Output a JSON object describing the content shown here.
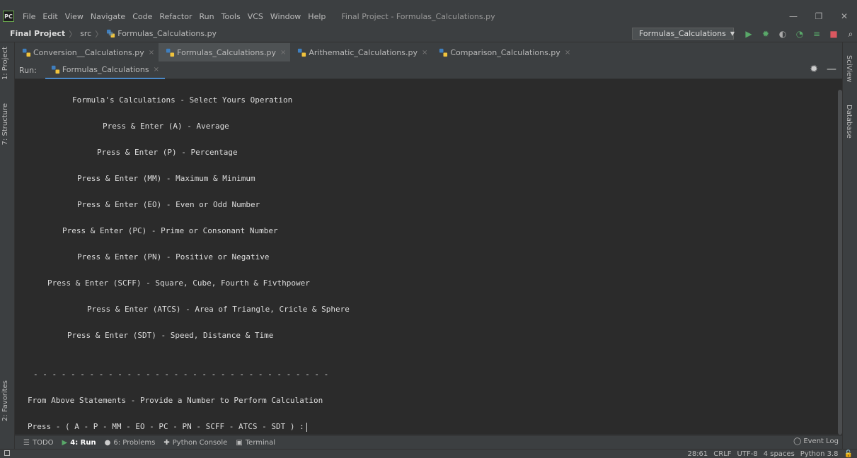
{
  "app": {
    "logo_text": "PC",
    "window_title": "Final Project - Formulas_Calculations.py"
  },
  "menu": [
    "File",
    "Edit",
    "View",
    "Navigate",
    "Code",
    "Refactor",
    "Run",
    "Tools",
    "VCS",
    "Window",
    "Help"
  ],
  "window_controls": {
    "minimize": "—",
    "restore": "❐",
    "close": "✕"
  },
  "navbar": {
    "project": "Final Project",
    "separator": "〉",
    "folder": "src",
    "file": "Formulas_Calculations.py",
    "run_config": "Formulas_Calculations",
    "run_config_caret": "▼"
  },
  "toolbar_icons": {
    "run": "▶",
    "debug": "✹",
    "coverage": "◐",
    "profile": "◔",
    "concurrency": "≡",
    "stop": "■",
    "search": "⌕"
  },
  "left_stripe": {
    "project": "1: Project",
    "structure": "7: Structure",
    "favorites": "2: Favorites"
  },
  "right_stripe": {
    "sciview": "SciView",
    "database": "Database"
  },
  "editor_tabs": [
    {
      "label": "Conversion__Calculations.py",
      "active": false
    },
    {
      "label": "Formulas_Calculations.py",
      "active": true
    },
    {
      "label": "Arithematic_Calculations.py",
      "active": false
    },
    {
      "label": "Comparison_Calculations.py",
      "active": false
    }
  ],
  "tab_close": "×",
  "run_panel": {
    "label": "Run:",
    "tab": "Formulas_Calculations",
    "settings": "✹",
    "minimize": "—"
  },
  "console_lines": [
    "Formula's Calculations - Select Yours Operation",
    "Press & Enter (A) - Average",
    "Press & Enter (P) - Percentage",
    "Press & Enter (MM) - Maximum & Minimum",
    "Press & Enter (EO) - Even or Odd Number",
    "Press & Enter (PC) - Prime or Consonant Number",
    "Press & Enter (PN) - Positive or Negative",
    "Press & Enter (SCFF) - Square, Cube, Fourth & Fivthpower",
    "Press & Enter (ATCS) - Area of Triangle, Cricle & Sphere",
    "Press & Enter (SDT) - Speed, Distance & Time",
    "- - - - - - - - - - - - - - - - - - - - - - - - - - - - - - - -",
    "From Above Statements - Provide a Number to Perform Calculation",
    "Press - ( A - P - MM - EO - PC - PN - SCFF - ATCS - SDT ) :"
  ],
  "bottom_tools": [
    {
      "icon": "☰",
      "label": "TODO",
      "active": false
    },
    {
      "icon": "▶",
      "label": "4: Run",
      "active": true
    },
    {
      "icon": "●",
      "label": "6: Problems",
      "active": false
    },
    {
      "icon": "✚",
      "label": "Python Console",
      "active": false
    },
    {
      "icon": "▣",
      "label": "Terminal",
      "active": false
    }
  ],
  "event_log": {
    "icon": "◯",
    "label": "Event Log"
  },
  "status": {
    "position": "28:61",
    "line_sep": "CRLF",
    "encoding": "UTF-8",
    "indent": "4 spaces",
    "interpreter": "Python 3.8",
    "lock": "🔓"
  },
  "colors": {
    "background": "#3c3f41",
    "console": "#2b2b2b",
    "accent": "#4a88c7",
    "run_green": "#59a869",
    "stop_red": "#db5860"
  }
}
